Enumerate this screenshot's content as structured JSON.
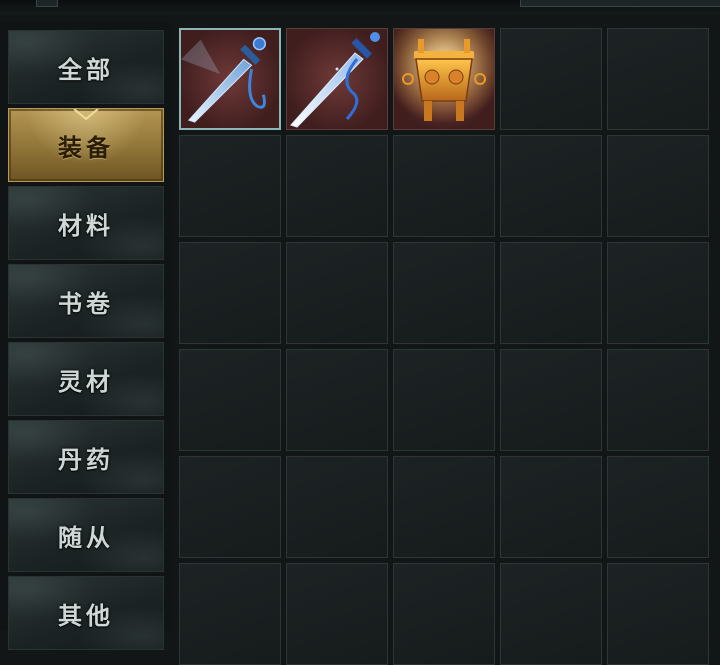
{
  "categories": [
    {
      "label": "全部",
      "active": false
    },
    {
      "label": "装备",
      "active": true
    },
    {
      "label": "材料",
      "active": false
    },
    {
      "label": "书卷",
      "active": false
    },
    {
      "label": "灵材",
      "active": false
    },
    {
      "label": "丹药",
      "active": false
    },
    {
      "label": "随从",
      "active": false
    },
    {
      "label": "其他",
      "active": false
    }
  ],
  "inventory": {
    "columns": 5,
    "visible_rows": 6,
    "items": [
      {
        "icon": "blue-sword-icon",
        "selected": true
      },
      {
        "icon": "ice-sword-icon",
        "selected": false
      },
      {
        "icon": "golden-cauldron-icon",
        "selected": false
      }
    ]
  },
  "colors": {
    "active_tab": "#b49654",
    "item_background": "#6f3a38",
    "selected_border": "#8ab6b8"
  }
}
